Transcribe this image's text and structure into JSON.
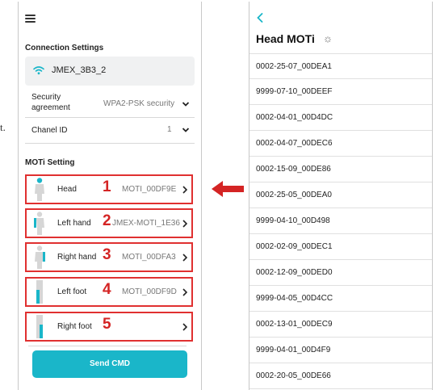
{
  "stray_text": "t.",
  "left": {
    "connection_title": "Connection Settings",
    "wifi_name": "JMEX_3B3_2",
    "security_label": "Security agreement",
    "security_value": "WPA2-PSK security",
    "channel_label": "Chanel ID",
    "channel_value": "1",
    "moti_title": "MOTi Setting",
    "moti_rows": [
      {
        "label": "Head",
        "num": "1",
        "value": "MOTI_00DF9E"
      },
      {
        "label": "Left hand",
        "num": "2",
        "value": "JMEX-MOTI_1E36"
      },
      {
        "label": "Right hand",
        "num": "3",
        "value": "MOTI_00DFA3"
      },
      {
        "label": "Left foot",
        "num": "4",
        "value": "MOTI_00DF9D"
      },
      {
        "label": "Right foot",
        "num": "5",
        "value": ""
      }
    ],
    "send_label": "Send CMD"
  },
  "right": {
    "title": "Head MOTi",
    "items": [
      "0002-25-07_00DEA1",
      "9999-07-10_00DEEF",
      "0002-04-01_00D4DC",
      "0002-04-07_00DEC6",
      "0002-15-09_00DE86",
      "0002-25-05_00DEA0",
      "9999-04-10_00D498",
      "0002-02-09_00DEC1",
      "0002-12-09_00DED0",
      "9999-04-05_00D4CC",
      "0002-13-01_00DEC9",
      "9999-04-01_00D4F9",
      "0002-20-05_00DE66"
    ]
  },
  "colors": {
    "accent": "#1ab6c9",
    "highlight_red": "#d42424",
    "box_border": "#e03030"
  },
  "icons": {
    "menu": "hamburger-icon",
    "wifi": "wifi-icon",
    "back": "chevron-left-icon",
    "loading": "spinner-icon",
    "dropdown": "chevron-down-icon",
    "row": "chevron-right-icon",
    "arrow": "arrow-left-icon"
  }
}
